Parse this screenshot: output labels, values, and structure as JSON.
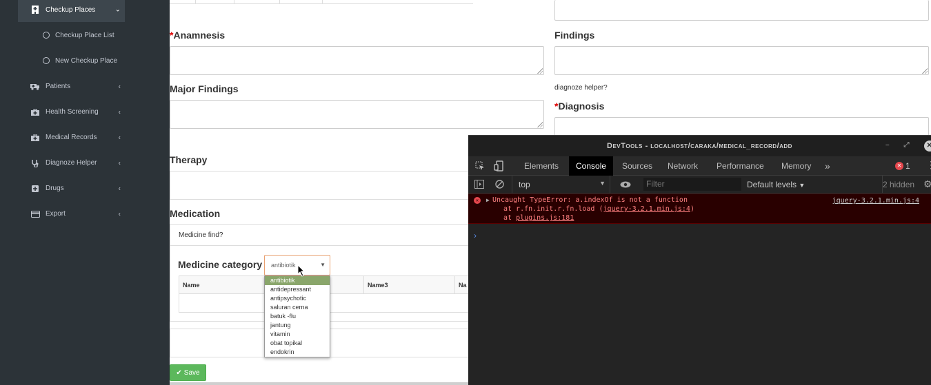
{
  "sidebar": {
    "items": [
      {
        "label": "Checkup Places",
        "icon": "clinic-icon",
        "active": true
      },
      {
        "label": "Patients",
        "icon": "ambulance-icon"
      },
      {
        "label": "Health Screening",
        "icon": "medkit-icon"
      },
      {
        "label": "Medical Records",
        "icon": "medkit-icon"
      },
      {
        "label": "Diagnoze Helper",
        "icon": "stethoscope-icon"
      },
      {
        "label": "Drugs",
        "icon": "plus-square-icon"
      },
      {
        "label": "Export",
        "icon": "credit-card-icon"
      }
    ],
    "subitems": [
      {
        "label": "Checkup Place List"
      },
      {
        "label": "New Checkup Place"
      }
    ]
  },
  "form": {
    "anamnesis_label": "Anamnesis",
    "required_mark": "*",
    "findings_label": "Findings",
    "major_findings_label": "Major Findings",
    "diagnoze_helper_text": "diagnoze helper?",
    "diagnosis_label": "Diagnosis",
    "therapy_label": "Therapy",
    "medication_label": "Medication",
    "medicine_find_text": "Medicine find?",
    "medicine_category_label": "Medicine category",
    "selected_category": "antibiotik",
    "category_options": [
      "antibiotik",
      "antidepressant",
      "antipsychotic",
      "saluran cerna",
      "batuk -flu",
      "jantung",
      "vitamin",
      "obat topikal",
      "endokrin"
    ],
    "table_headers": [
      "Name",
      "Name3",
      "Na"
    ],
    "save_label": "Save",
    "save_check": "✔"
  },
  "devtools": {
    "title": "DevTools - localhost/caraka/medical_record/add",
    "tabs": [
      "Elements",
      "Console",
      "Sources",
      "Network",
      "Performance",
      "Memory"
    ],
    "more_tabs": "»",
    "error_count": "1",
    "context": "top",
    "filter_placeholder": "Filter",
    "levels": "Default levels",
    "hidden": "2 hidden",
    "error": {
      "message": "Uncaught TypeError: a.indexOf is not a function",
      "line2_prefix": "at r.fn.init.r.fn.load (",
      "line2_link": "jquery-3.2.1.min.js:4",
      "line2_suffix": ")",
      "line3_prefix": "at ",
      "line3_link": "plugins.js:181",
      "source": "jquery-3.2.1.min.js:4"
    }
  },
  "colors": {
    "sidebar_bg": "#2c3338",
    "save_green": "#5cb85c",
    "option_selected": "#8aa66b",
    "error_bg": "#290000"
  }
}
